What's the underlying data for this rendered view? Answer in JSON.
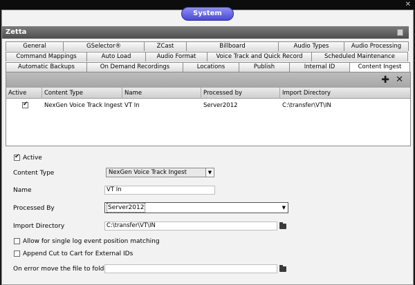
{
  "window": {
    "title": "System",
    "close_glyph": "✕"
  },
  "panel": {
    "title": "Zetta",
    "pin_icon": "pin-icon"
  },
  "tabs": {
    "row1": [
      {
        "label": "General"
      },
      {
        "label": "GSelector®"
      },
      {
        "label": "ZCast"
      },
      {
        "label": "Billboard"
      },
      {
        "label": "Audio Types"
      },
      {
        "label": "Audio Processing"
      }
    ],
    "row2": [
      {
        "label": "Command Mappings"
      },
      {
        "label": "Auto Load"
      },
      {
        "label": "Audio Format"
      },
      {
        "label": "Voice Track and Quick Record"
      },
      {
        "label": "Scheduled Maintenance"
      }
    ],
    "row3": [
      {
        "label": "Automatic Backups"
      },
      {
        "label": "On Demand Recordings"
      },
      {
        "label": "Locations"
      },
      {
        "label": "Publish"
      },
      {
        "label": "Internal ID"
      },
      {
        "label": "Content Ingest",
        "active": true
      }
    ]
  },
  "toolbar": {
    "add_glyph": "✚",
    "delete_glyph": "✕"
  },
  "grid": {
    "columns": [
      "Active",
      "Content Type",
      "Name",
      "Processed by",
      "Import Directory"
    ],
    "rows": [
      {
        "active": true,
        "content_type": "NexGen Voice Track Ingest",
        "name": "VT In",
        "processed_by": "Server2012",
        "import_directory": "C:\\transfer\\VT\\IN"
      }
    ]
  },
  "form": {
    "active_label": "Active",
    "active_checked": true,
    "content_type_label": "Content Type",
    "content_type_value": "NexGen Voice Track Ingest",
    "name_label": "Name",
    "name_value": "VT In",
    "processed_by_label": "Processed By",
    "processed_by_value": "Server2012",
    "import_directory_label": "Import Directory",
    "import_directory_value": "C:\\transfer\\VT\\IN",
    "single_log_label": "Allow for single log event position matching",
    "append_cut_label": "Append Cut to Cart for External IDs",
    "on_error_label": "On error move the file to folder",
    "on_error_value": ""
  },
  "colors": {
    "accent": "#5a5ae0",
    "header": "#5e5e5e"
  }
}
